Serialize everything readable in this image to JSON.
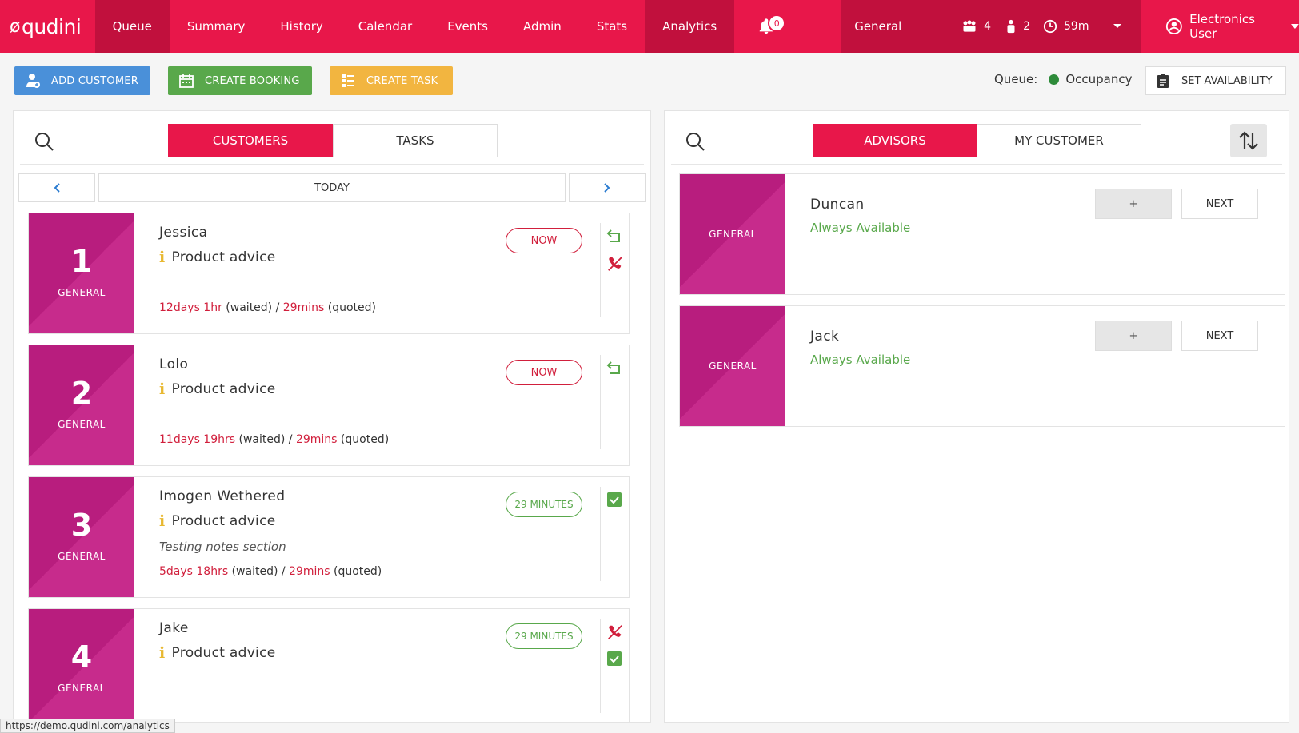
{
  "app": {
    "logo": "qudini"
  },
  "nav": {
    "items": [
      {
        "label": "Queue"
      },
      {
        "label": "Summary"
      },
      {
        "label": "History"
      },
      {
        "label": "Calendar"
      },
      {
        "label": "Events"
      },
      {
        "label": "Admin"
      },
      {
        "label": "Stats"
      },
      {
        "label": "Analytics"
      }
    ],
    "notifications": "0",
    "queue_name": "General",
    "stats": {
      "group_count": "4",
      "person_count": "2",
      "time": "59m"
    },
    "user": "Electronics User"
  },
  "actions": {
    "add_customer": "ADD CUSTOMER",
    "create_booking": "CREATE BOOKING",
    "create_task": "CREATE TASK",
    "queue_label": "Queue:",
    "queue_status": "Occupancy",
    "set_availability": "SET AVAILABILITY"
  },
  "left": {
    "tabs": [
      {
        "label": "CUSTOMERS"
      },
      {
        "label": "TASKS"
      }
    ],
    "day": "TODAY",
    "customers": [
      {
        "pos": "1",
        "group": "GENERAL",
        "name": "Jessica",
        "service": "Product advice",
        "note": "",
        "waited": "12days 1hr",
        "waited_suffix": " (waited) / ",
        "quoted": "29mins",
        "quoted_suffix": " (quoted)",
        "status": "NOW"
      },
      {
        "pos": "2",
        "group": "GENERAL",
        "name": "Lolo",
        "service": "Product advice",
        "note": "",
        "waited": "11days 19hrs",
        "waited_suffix": " (waited) / ",
        "quoted": "29mins",
        "quoted_suffix": " (quoted)",
        "status": "NOW"
      },
      {
        "pos": "3",
        "group": "GENERAL",
        "name": "Imogen Wethered",
        "service": "Product advice",
        "note": "Testing notes section",
        "waited": "5days 18hrs",
        "waited_suffix": " (waited) / ",
        "quoted": "29mins",
        "quoted_suffix": " (quoted)",
        "status": "29 MINUTES"
      },
      {
        "pos": "4",
        "group": "GENERAL",
        "name": "Jake",
        "service": "Product advice",
        "note": "",
        "waited": "",
        "waited_suffix": "",
        "quoted": "",
        "quoted_suffix": "",
        "status": "29 MINUTES"
      }
    ]
  },
  "right": {
    "tabs": [
      {
        "label": "ADVISORS"
      },
      {
        "label": "MY CUSTOMER"
      }
    ],
    "advisors": [
      {
        "group": "GENERAL",
        "name": "Duncan",
        "availability": "Always Available",
        "plus": "+",
        "next": "NEXT"
      },
      {
        "group": "GENERAL",
        "name": "Jack",
        "availability": "Always Available",
        "plus": "+",
        "next": "NEXT"
      }
    ]
  },
  "statusbar": {
    "url": "https://demo.qudini.com/analytics"
  },
  "colors": {
    "brand": "#e8174a",
    "brand_dark": "#c1103d",
    "magenta": "#b81d7e",
    "green": "#59a84b",
    "blue": "#4a90d9",
    "yellow": "#f2b540"
  }
}
